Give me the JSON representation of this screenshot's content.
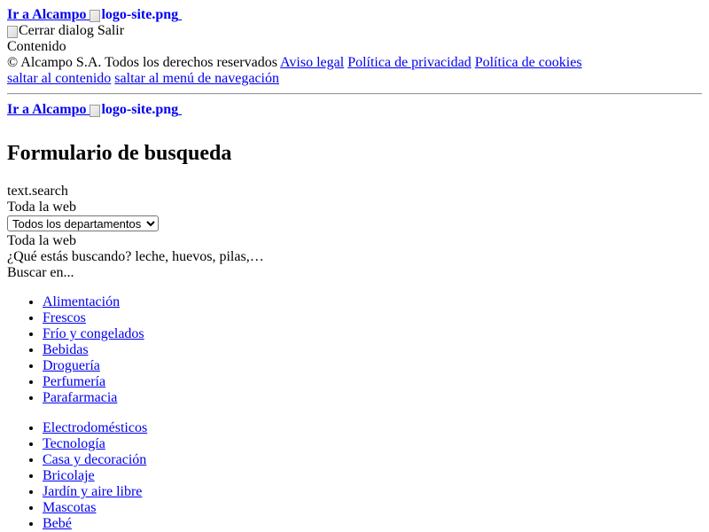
{
  "header": {
    "home_link_label": "Ir a Alcampo",
    "logo_alt": "logo-site.png"
  },
  "dialog": {
    "close_alt": "Cerrar dialog",
    "exit_label": "Salir",
    "content_label": "Contenido"
  },
  "footer": {
    "copyright": "© Alcampo S.A. Todos los derechos reservados",
    "links": [
      "Aviso legal",
      "Política de privacidad",
      "Política de cookies"
    ]
  },
  "skip_links": [
    "saltar al contenido",
    "saltar al menú de navegación"
  ],
  "header2": {
    "home_link_label": "Ir a Alcampo",
    "logo_alt": "logo-site.png"
  },
  "search_form": {
    "title": "Formulario de busqueda",
    "search_key": "text.search",
    "scope_label": "Toda la web",
    "department_select": "Todos los departamentos",
    "scope_label_2": "Toda la web",
    "placeholder_text": "¿Qué estás buscando? leche, huevos, pilas,…",
    "search_in_label": "Buscar en..."
  },
  "menu_groups": [
    [
      "Alimentación",
      "Frescos",
      "Frío y congelados",
      "Bebidas",
      "Droguería",
      "Perfumería",
      "Parafarmacia"
    ],
    [
      "Electrodomésticos",
      "Tecnología",
      "Casa y decoración",
      "Bricolaje",
      "Jardín y aire libre",
      "Mascotas",
      "Bebé"
    ]
  ]
}
